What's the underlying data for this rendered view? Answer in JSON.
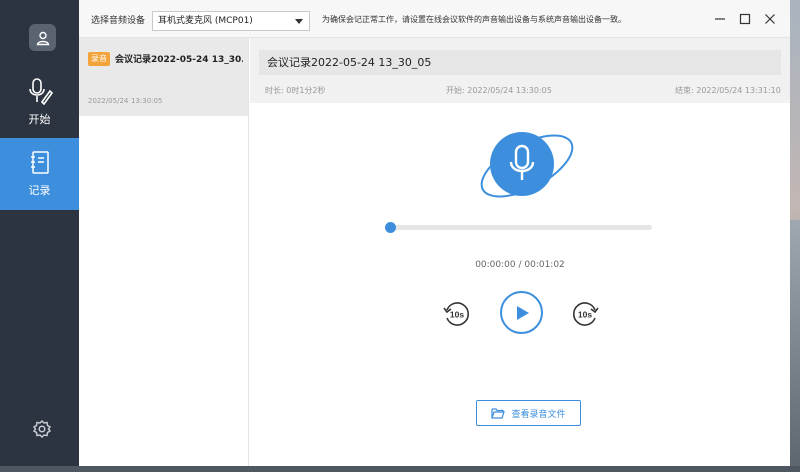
{
  "topbar": {
    "select_label": "选择音频设备",
    "device_value": "耳机式麦克风 (MCP01)",
    "notice": "为确保会记正常工作，请设置在线会议软件的声音输出设备与系统声音输出设备一致。"
  },
  "sidebar": {
    "items": [
      {
        "label": "开始",
        "icon": "mic-edit-icon"
      },
      {
        "label": "记录",
        "icon": "notebook-icon"
      }
    ]
  },
  "list": {
    "items": [
      {
        "tag": "录音",
        "title": "会议记录2022-05-24 13_30...",
        "date": "2022/05/24",
        "time": "13:30:05"
      }
    ]
  },
  "detail": {
    "title": "会议记录2022-05-24 13_30_05",
    "duration": "时长:  0时1分2秒",
    "start": "开始:    2022/05/24 13:30:05",
    "end": "结束:    2022/05/24 13:31:10"
  },
  "player": {
    "time": "00:00:00 / 00:01:02",
    "progress": 0,
    "back_label": "10s",
    "forward_label": "10s"
  },
  "actions": {
    "open_file": "查看录音文件"
  },
  "colors": {
    "accent": "#3d8fde",
    "sidebar": "#2b3440",
    "tag": "#f2a33a"
  }
}
